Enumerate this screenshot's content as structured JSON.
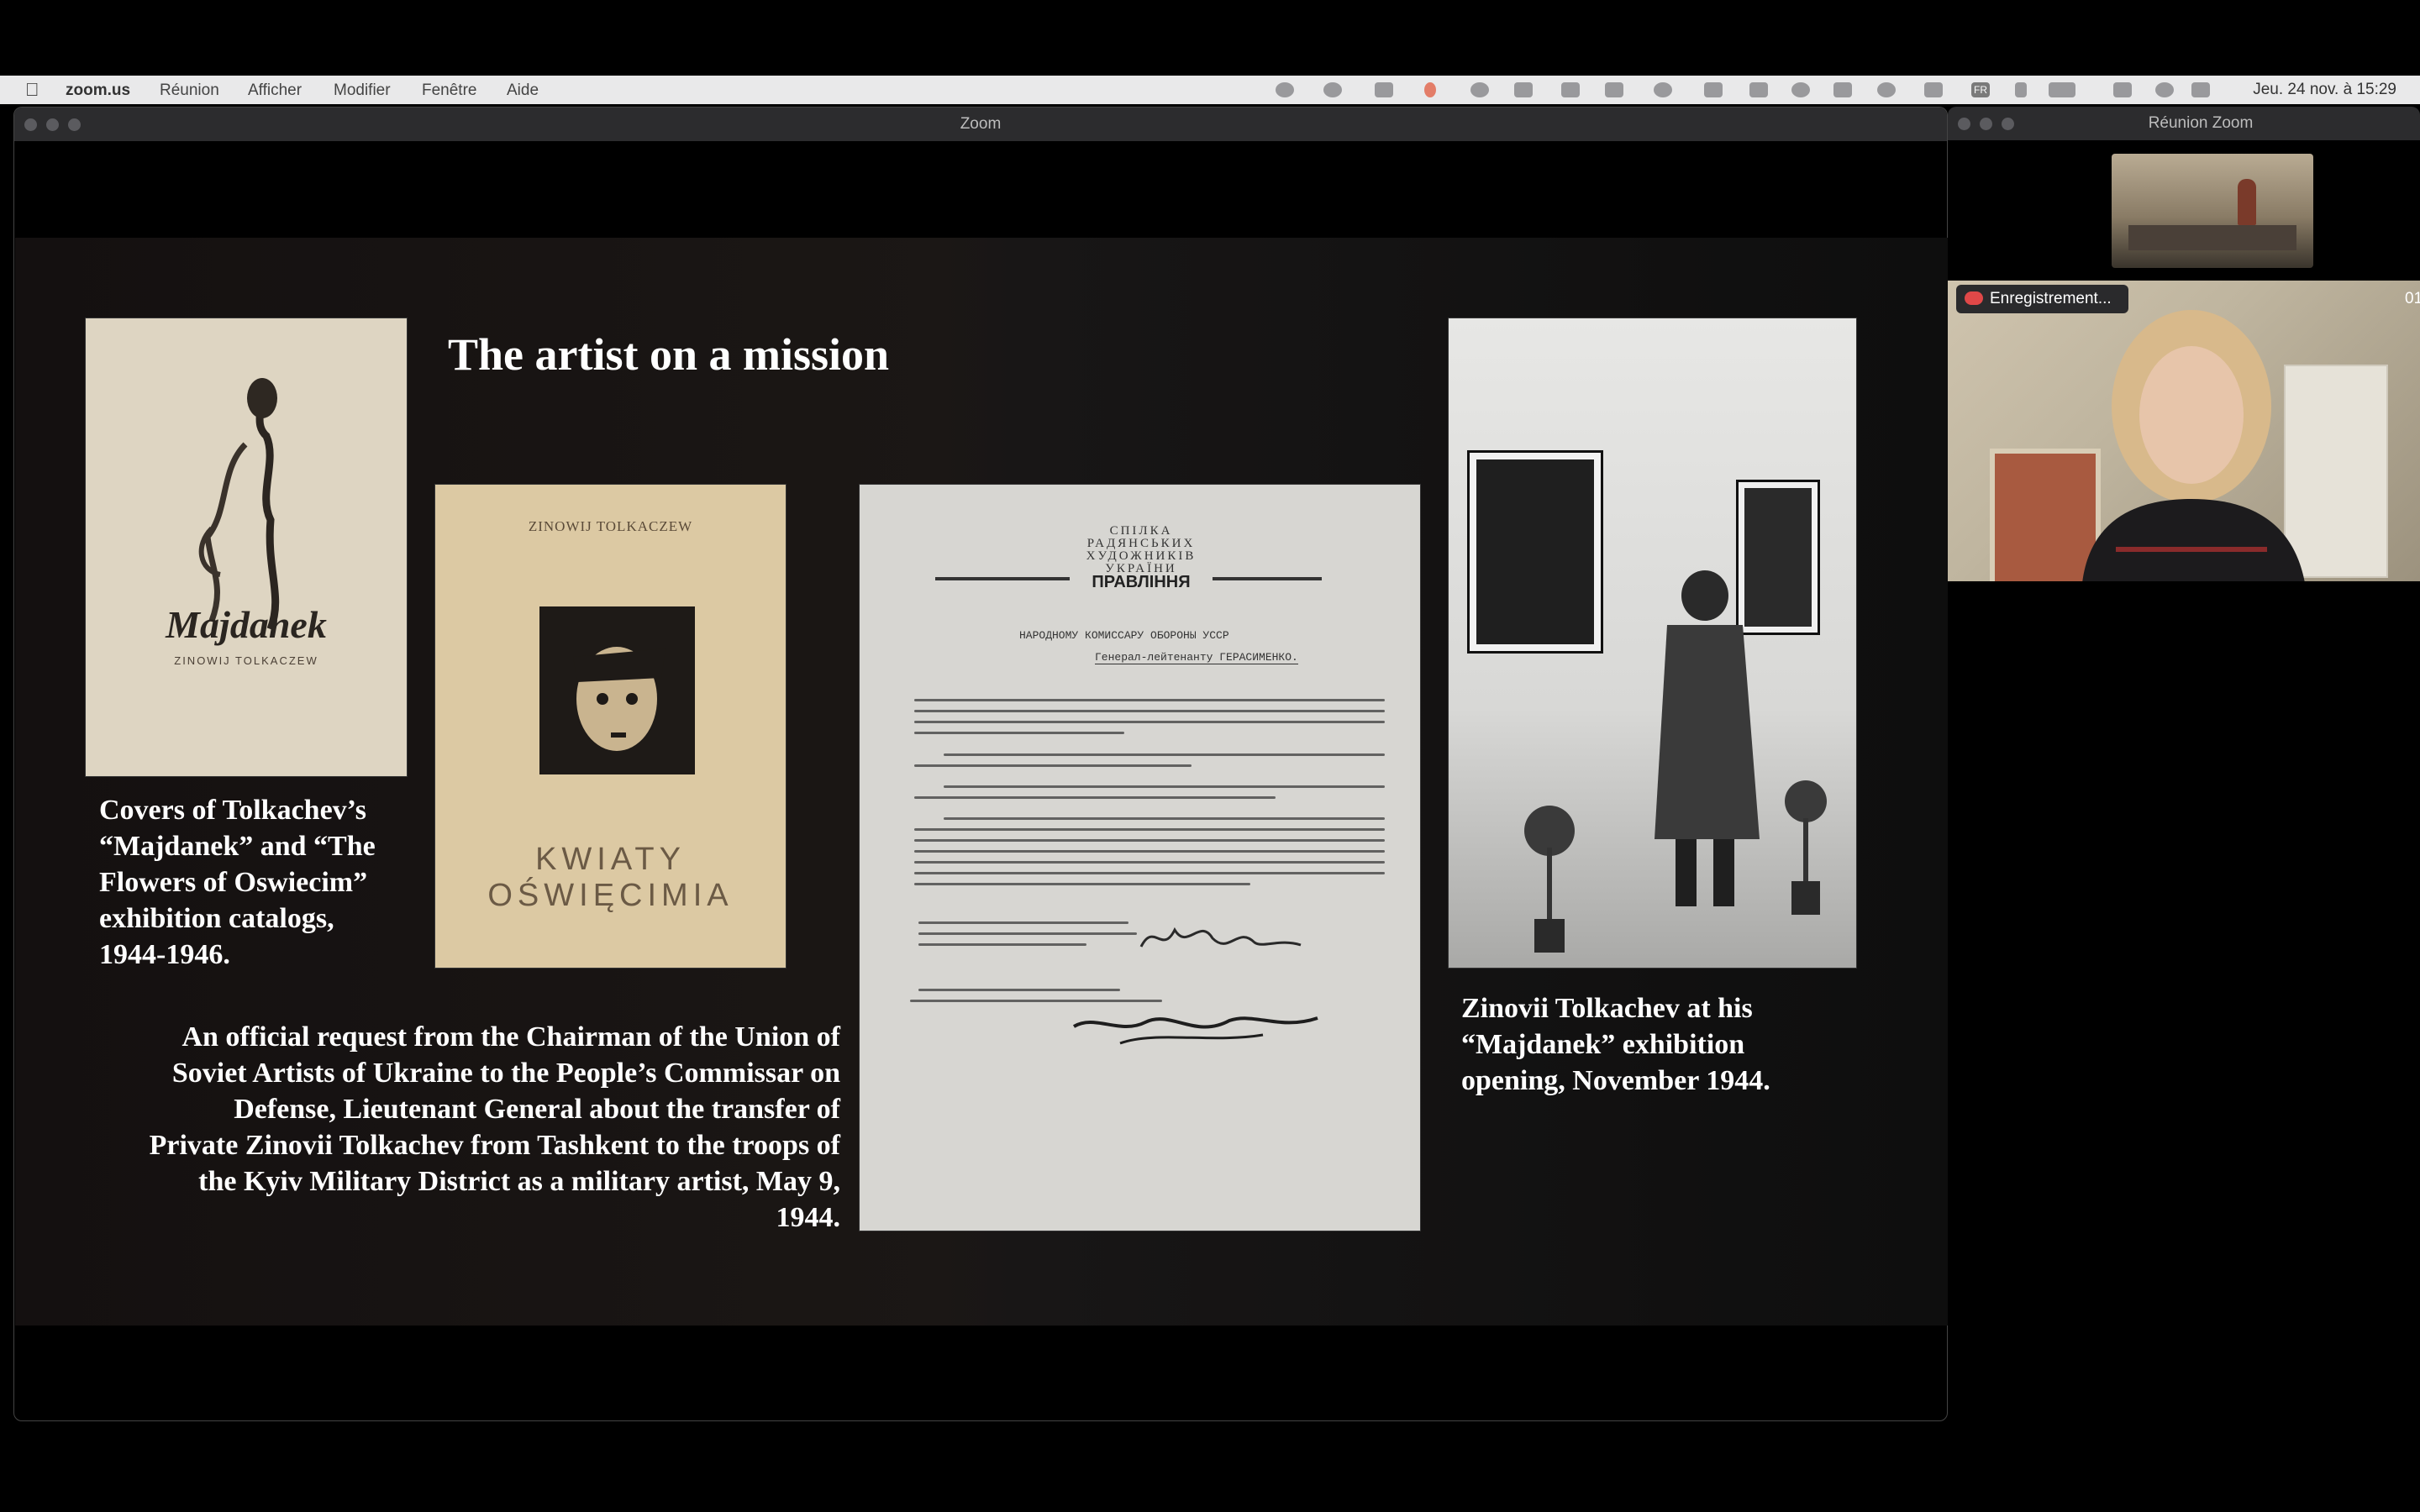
{
  "menubar": {
    "app_name": "zoom.us",
    "menus": [
      "Réunion",
      "Afficher",
      "Modifier",
      "Fenêtre",
      "Aide"
    ],
    "datetime": "Jeu. 24 nov. à 15:29",
    "language_badge": "FR"
  },
  "main_window": {
    "title": "Zoom"
  },
  "side_window": {
    "title": "Réunion Zoom",
    "recording_label": "Enregistrement...",
    "edge_counter": "01"
  },
  "slide": {
    "title": "The artist on a mission",
    "book1": {
      "title": "Majdanek",
      "author": "ZINOWIJ TOLKACZEW"
    },
    "book2": {
      "author": "ZINOWIJ TOLKACZEW",
      "title_line1": "KWIATY",
      "title_line2": "OŚWIĘCIMIA"
    },
    "caption_left": [
      "Covers of Tolkachev’s",
      "“Majdanek” and “The",
      "Flowers of Oswiecim”",
      "exhibition catalogs,",
      "1944-1946."
    ],
    "caption_bottom": [
      "An official request from the Chairman of the Union of",
      "Soviet Artists of Ukraine to the People’s Commissar on",
      "Defense, Lieutenant  General about the transfer of",
      "Private Zinovii Tolkachev from Tashkent to the troops of",
      "the Kyiv Military District as a military artist, May 9,",
      "1944."
    ],
    "caption_right": [
      "Zinovii Tolkachev at his",
      "“Majdanek” exhibition",
      "opening, November 1944."
    ],
    "document": {
      "header_line1": "СПІЛКА",
      "header_line2": "РАДЯНСЬКИХ",
      "header_line3": "ХУДОЖНИКІВ",
      "header_line4": "УКРАЇНИ",
      "header_line5": "ПРАВЛІННЯ",
      "addressee1": "НАРОДНОМУ КОМИССАРУ ОБОРОНЫ УССР",
      "addressee2": "Генерал-лейтенанту ГЕРАСИМЕНКО."
    }
  }
}
